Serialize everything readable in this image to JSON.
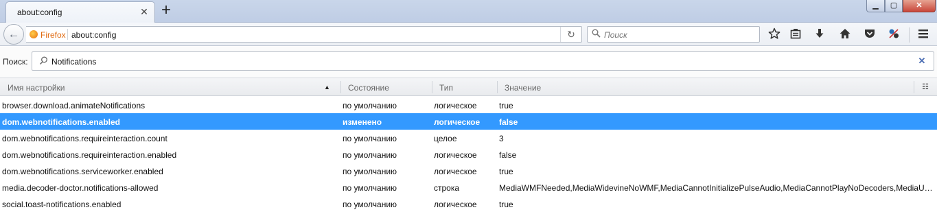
{
  "tab": {
    "title": "about:config",
    "close_glyph": "✕",
    "new_tab_glyph": "+"
  },
  "window": {
    "minimize_glyph": "▁",
    "maximize_glyph": "▢",
    "close_glyph": "✕"
  },
  "navbar": {
    "back_glyph": "←",
    "identity_label": "Firefox",
    "url": "about:config",
    "reload_glyph": "↻",
    "search_placeholder": "Поиск"
  },
  "toolbar_icons": [
    "bookmark-star-icon",
    "reading-list-icon",
    "downloads-icon",
    "home-icon",
    "pocket-icon",
    "addon-icon",
    "menu-icon"
  ],
  "config": {
    "search_label": "Поиск:",
    "filter_value": "Notifications",
    "clear_glyph": "✕",
    "columns": {
      "name": "Имя настройки",
      "status": "Состояние",
      "type": "Тип",
      "value": "Значение"
    },
    "sort_glyph": "▲",
    "column_picker_glyph": "☷",
    "rows": [
      {
        "name": "browser.download.animateNotifications",
        "status": "по умолчанию",
        "type": "логическое",
        "value": "true"
      },
      {
        "name": "dom.webnotifications.enabled",
        "status": "изменено",
        "type": "логическое",
        "value": "false"
      },
      {
        "name": "dom.webnotifications.requireinteraction.count",
        "status": "по умолчанию",
        "type": "целое",
        "value": "3"
      },
      {
        "name": "dom.webnotifications.requireinteraction.enabled",
        "status": "по умолчанию",
        "type": "логическое",
        "value": "false"
      },
      {
        "name": "dom.webnotifications.serviceworker.enabled",
        "status": "по умолчанию",
        "type": "логическое",
        "value": "true"
      },
      {
        "name": "media.decoder-doctor.notifications-allowed",
        "status": "по умолчанию",
        "type": "строка",
        "value": "MediaWMFNeeded,MediaWidevineNoWMF,MediaCannotInitializePulseAudio,MediaCannotPlayNoDecoders,MediaUns..."
      },
      {
        "name": "social.toast-notifications.enabled",
        "status": "по умолчанию",
        "type": "логическое",
        "value": "true"
      }
    ]
  },
  "colors": {
    "selection": "#3399ff",
    "firefox_orange": "#e06a10",
    "clear_blue": "#4a6cb3"
  }
}
